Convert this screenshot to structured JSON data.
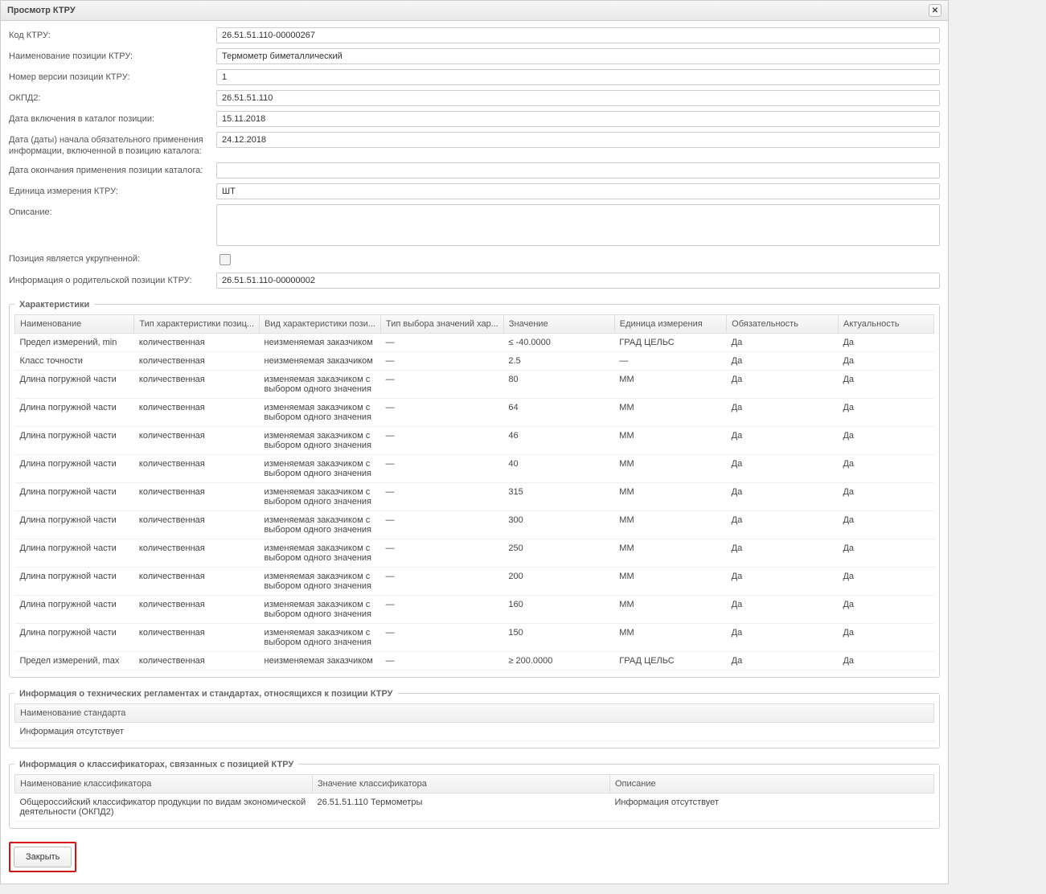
{
  "window": {
    "title": "Просмотр КТРУ"
  },
  "form": {
    "code_label": "Код КТРУ:",
    "code_value": "26.51.51.110-00000267",
    "name_label": "Наименование позиции КТРУ:",
    "name_value": "Термометр биметаллический",
    "version_label": "Номер версии позиции КТРУ:",
    "version_value": "1",
    "okpd2_label": "ОКПД2:",
    "okpd2_value": "26.51.51.110",
    "include_date_label": "Дата включения в каталог позиции:",
    "include_date_value": "15.11.2018",
    "mandatory_date_label": "Дата (даты) начала обязательного применения информации, включенной в позицию каталога:",
    "mandatory_date_value": "24.12.2018",
    "end_date_label": "Дата окончания применения позиции каталога:",
    "end_date_value": "",
    "unit_label": "Единица измерения КТРУ:",
    "unit_value": "ШТ",
    "desc_label": "Описание:",
    "desc_value": "",
    "enlarged_label": "Позиция является укрупненной:",
    "parent_label": "Информация о родительской позиции КТРУ:",
    "parent_value": "26.51.51.110-00000002"
  },
  "char": {
    "legend": "Характеристики",
    "headers": [
      "Наименование",
      "Тип характеристики позиц...",
      "Вид характеристики пози...",
      "Тип выбора значений хар...",
      "Значение",
      "Единица измерения",
      "Обязательность",
      "Актуальность"
    ],
    "rows": [
      [
        "Предел измерений, min",
        "количественная",
        "неизменяемая заказчиком",
        "—",
        "≤ -40.0000",
        "ГРАД ЦЕЛЬС",
        "Да",
        "Да"
      ],
      [
        "Класс точности",
        "количественная",
        "неизменяемая заказчиком",
        "—",
        "2.5",
        "—",
        "Да",
        "Да"
      ],
      [
        "Длина погружной части",
        "количественная",
        "изменяемая заказчиком с выбором одного значения",
        "—",
        "80",
        "ММ",
        "Да",
        "Да"
      ],
      [
        "Длина погружной части",
        "количественная",
        "изменяемая заказчиком с выбором одного значения",
        "—",
        "64",
        "ММ",
        "Да",
        "Да"
      ],
      [
        "Длина погружной части",
        "количественная",
        "изменяемая заказчиком с выбором одного значения",
        "—",
        "46",
        "ММ",
        "Да",
        "Да"
      ],
      [
        "Длина погружной части",
        "количественная",
        "изменяемая заказчиком с выбором одного значения",
        "—",
        "40",
        "ММ",
        "Да",
        "Да"
      ],
      [
        "Длина погружной части",
        "количественная",
        "изменяемая заказчиком с выбором одного значения",
        "—",
        "315",
        "ММ",
        "Да",
        "Да"
      ],
      [
        "Длина погружной части",
        "количественная",
        "изменяемая заказчиком с выбором одного значения",
        "—",
        "300",
        "ММ",
        "Да",
        "Да"
      ],
      [
        "Длина погружной части",
        "количественная",
        "изменяемая заказчиком с выбором одного значения",
        "—",
        "250",
        "ММ",
        "Да",
        "Да"
      ],
      [
        "Длина погружной части",
        "количественная",
        "изменяемая заказчиком с выбором одного значения",
        "—",
        "200",
        "ММ",
        "Да",
        "Да"
      ],
      [
        "Длина погружной части",
        "количественная",
        "изменяемая заказчиком с выбором одного значения",
        "—",
        "160",
        "ММ",
        "Да",
        "Да"
      ],
      [
        "Длина погружной части",
        "количественная",
        "изменяемая заказчиком с выбором одного значения",
        "—",
        "150",
        "ММ",
        "Да",
        "Да"
      ],
      [
        "Предел измерений, max",
        "количественная",
        "неизменяемая заказчиком",
        "—",
        "≥ 200.0000",
        "ГРАД ЦЕЛЬС",
        "Да",
        "Да"
      ]
    ]
  },
  "standards": {
    "legend": "Информация о технических регламентах и стандартах, относящихся к позиции КТРУ",
    "header": "Наименование стандарта",
    "empty": "Информация отсутствует"
  },
  "classifiers": {
    "legend": "Информация о классификаторах, связанных с позицией КТРУ",
    "headers": [
      "Наименование классификатора",
      "Значение классификатора",
      "Описание"
    ],
    "rows": [
      [
        "Общероссийский классификатор продукции по видам экономической деятельности (ОКПД2)",
        "26.51.51.110 Термометры",
        "Информация отсутствует"
      ]
    ]
  },
  "buttons": {
    "close": "Закрыть"
  }
}
